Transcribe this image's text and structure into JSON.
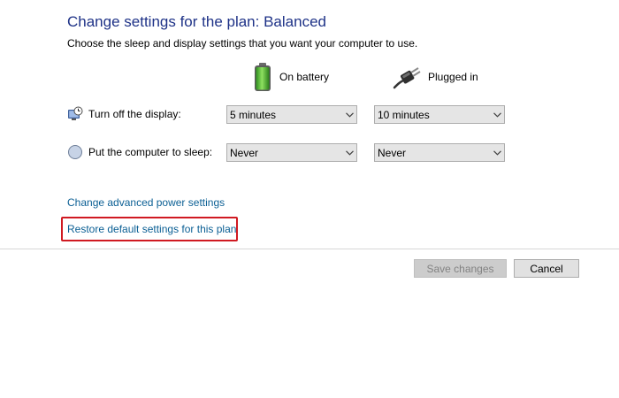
{
  "header": {
    "title": "Change settings for the plan: Balanced",
    "subtitle": "Choose the sleep and display settings that you want your computer to use."
  },
  "columns": {
    "battery": {
      "label": "On battery",
      "icon": "battery-icon"
    },
    "plugged": {
      "label": "Plugged in",
      "icon": "power-plug-icon"
    }
  },
  "settings": {
    "display": {
      "label": "Turn off the display:",
      "icon": "monitor-clock-icon",
      "battery_value": "5 minutes",
      "plugged_value": "10 minutes"
    },
    "sleep": {
      "label": "Put the computer to sleep:",
      "icon": "moon-sleep-icon",
      "battery_value": "Never",
      "plugged_value": "Never"
    }
  },
  "links": {
    "advanced": "Change advanced power settings",
    "restore": "Restore default settings for this plan"
  },
  "buttons": {
    "save": "Save changes",
    "cancel": "Cancel",
    "save_enabled": false
  },
  "colors": {
    "title": "#1e3287",
    "link": "#0b5f94",
    "highlight": "#d01a22"
  }
}
